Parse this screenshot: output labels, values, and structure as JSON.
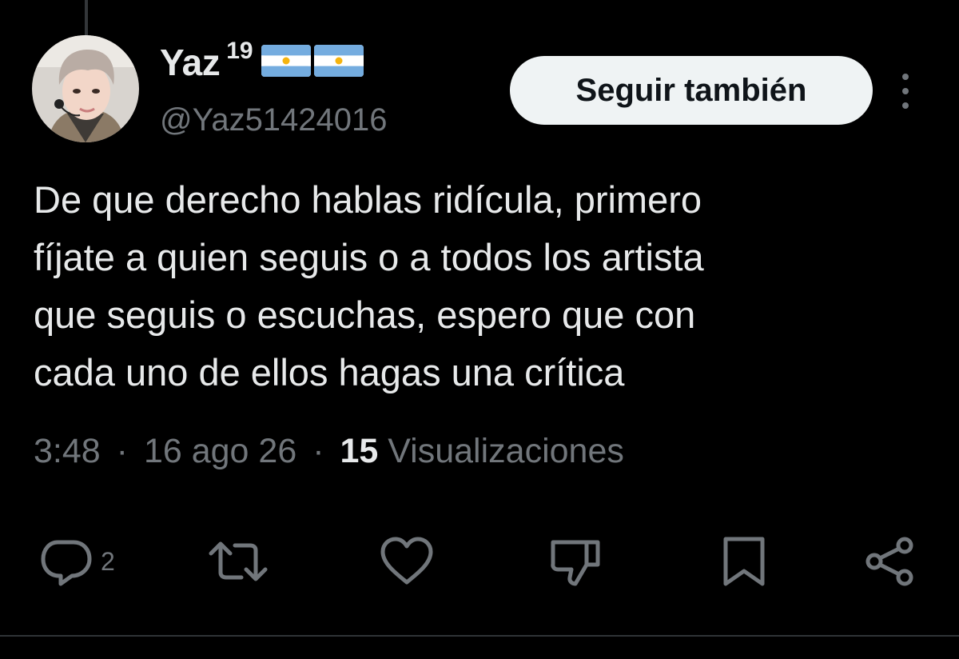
{
  "author": {
    "display_name": "Yaz",
    "name_suffix": "19",
    "flags": [
      "argentina-flag",
      "argentina-flag"
    ],
    "handle": "@Yaz51424016"
  },
  "follow_button_label": "Seguir también",
  "tweet": {
    "text_lines": [
      "De que derecho hablas ridícula, primero",
      "fíjate a quien seguis o a todos los artista",
      "que seguis o escuchas, espero que con",
      "cada uno de ellos hagas una crítica"
    ]
  },
  "meta": {
    "time": "3:48",
    "separator": "·",
    "date": "16 ago 26",
    "views_count": "15",
    "views_label": "Visualizaciones"
  },
  "actions": {
    "reply": {
      "icon": "reply-icon",
      "count": "2"
    },
    "retweet": {
      "icon": "retweet-icon"
    },
    "like": {
      "icon": "heart-icon"
    },
    "dislike": {
      "icon": "thumbs-down-icon"
    },
    "bookmark": {
      "icon": "bookmark-icon"
    },
    "share": {
      "icon": "share-icon"
    }
  },
  "colors": {
    "background": "#000000",
    "text_primary": "#e7e9ea",
    "text_secondary": "#71767b",
    "button_background": "#eff3f4",
    "flag_blue": "#74acdf",
    "flag_sun": "#f6b40e"
  }
}
